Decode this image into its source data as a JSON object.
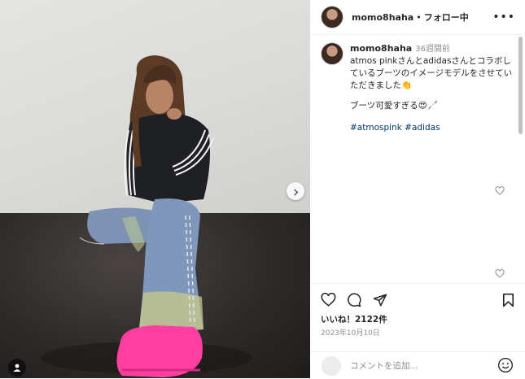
{
  "post": {
    "username": "momo8haha",
    "header_separator": "•",
    "follow_label": "フォロー中",
    "more_icon": "more-horizontal-icon"
  },
  "caption": {
    "username": "momo8haha",
    "time_ago": "36週間前",
    "line1": "atmos pinkさんとadidasさんとコラボしているブーツのイメージモデルをさせていただきました👏",
    "line2": "ブーツ可愛すぎる😍🦯",
    "hashtags": [
      "#atmospink",
      "#adidas"
    ]
  },
  "stats": {
    "likes": "いいね！2122件",
    "date": "2023年10月10日"
  },
  "comment": {
    "placeholder": "コメントを追加..."
  },
  "colors": {
    "hashtag": "#00376b",
    "text": "#262626",
    "muted": "#8e8e8e",
    "boot": "#ff3fa0"
  },
  "icons": {
    "like": "heart-icon",
    "comment": "comment-bubble-icon",
    "share": "paper-plane-icon",
    "save": "bookmark-icon",
    "next": "chevron-right-icon",
    "tag": "user-tag-icon",
    "emoji": "smiley-icon"
  }
}
